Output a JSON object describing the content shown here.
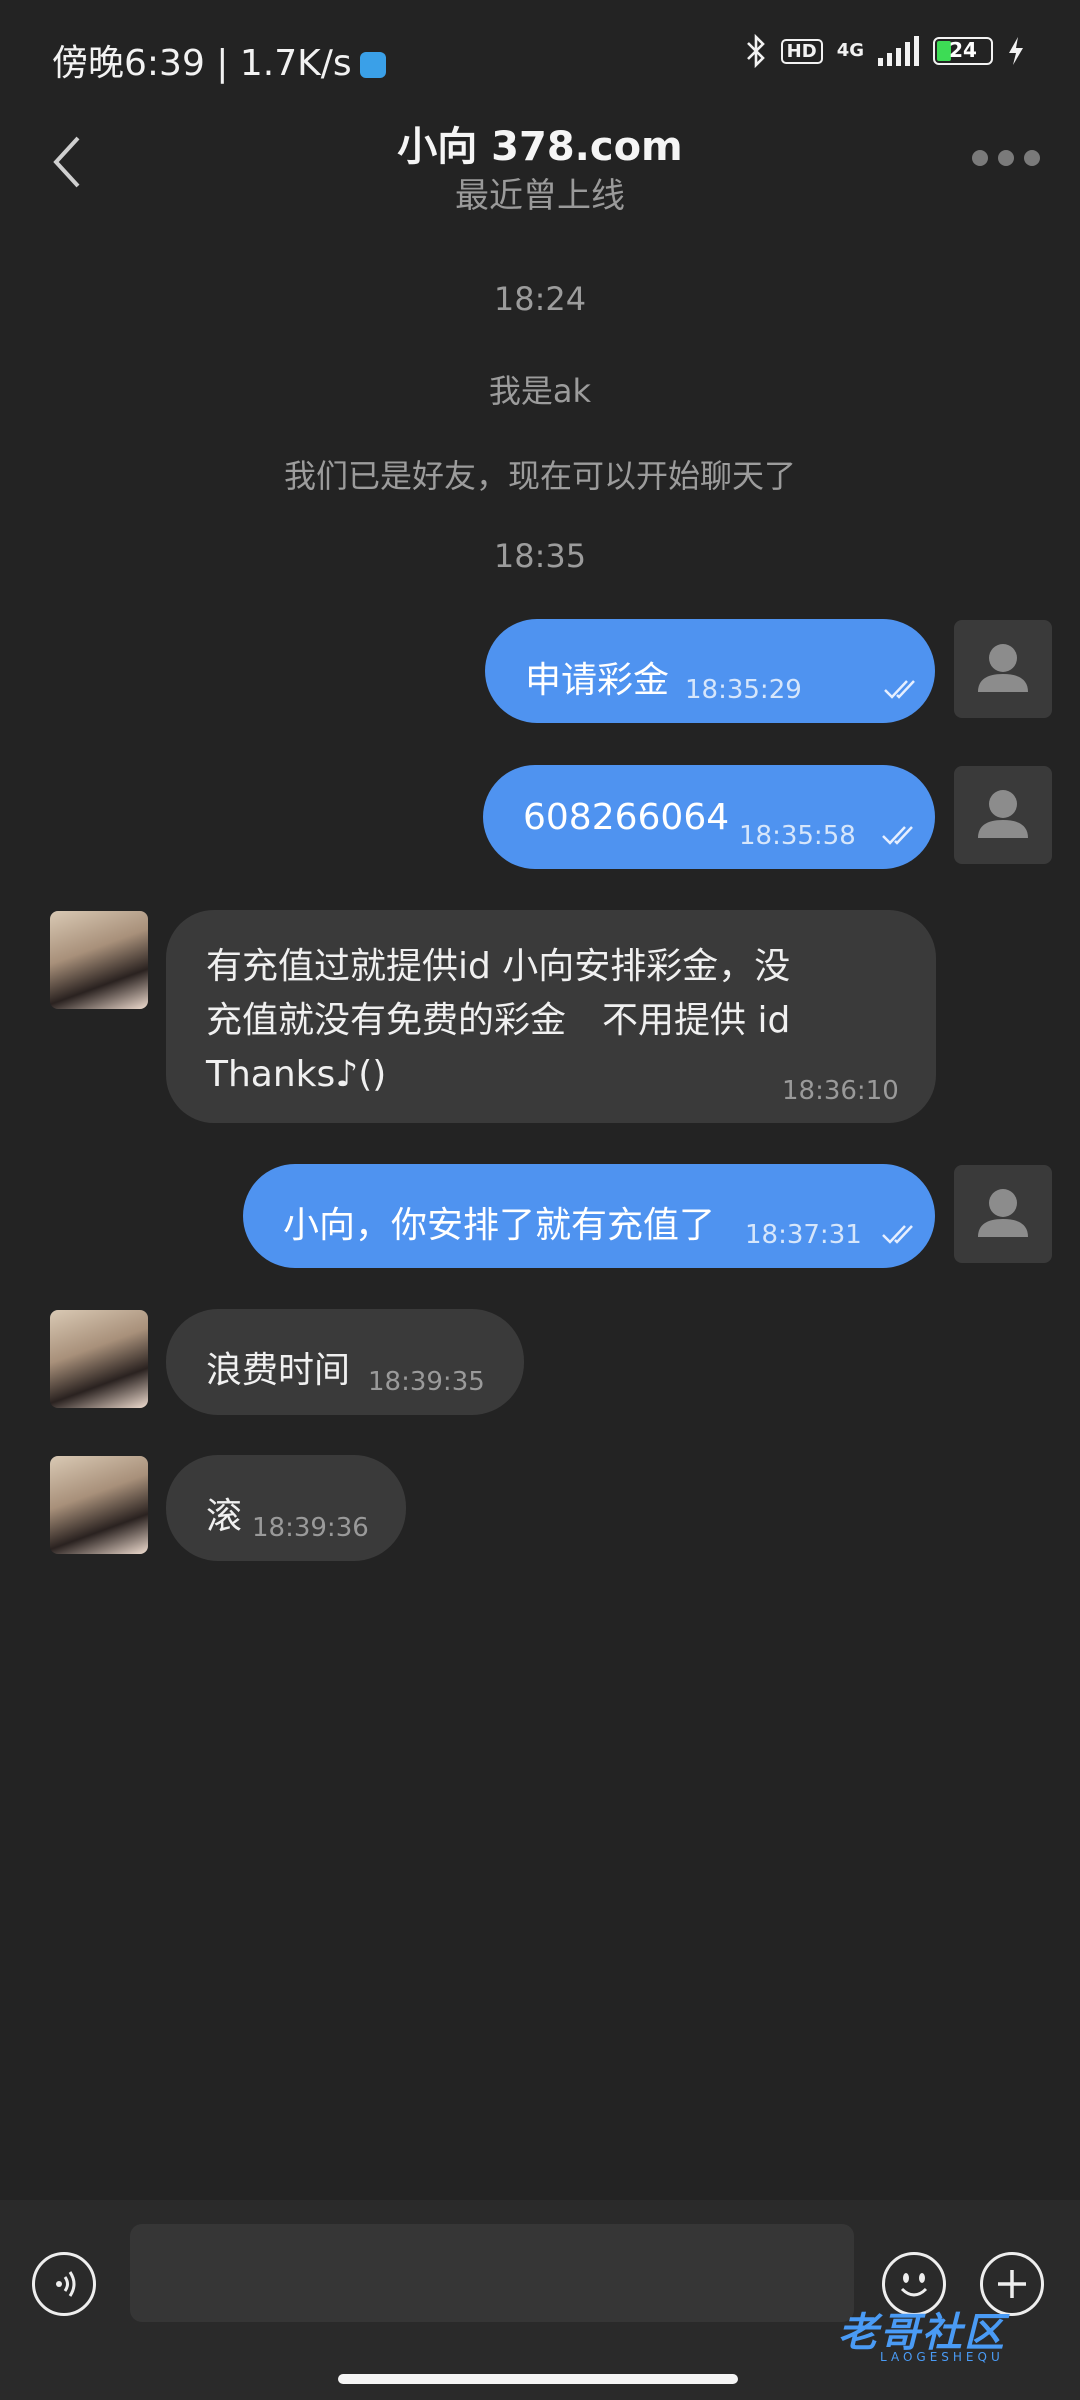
{
  "status_bar": {
    "time": "傍晚6:39 | 1.7K/s",
    "network_type": "4G",
    "hd_label": "HD",
    "battery": "24"
  },
  "header": {
    "title": "小向 378.com",
    "subtitle": "最近曾上线"
  },
  "system_messages": [
    {
      "text": "18:24"
    },
    {
      "text": "我是ak"
    },
    {
      "text": "我们已是好友，现在可以开始聊天了"
    },
    {
      "text": "18:35"
    }
  ],
  "messages": [
    {
      "side": "out",
      "text": "申请彩金",
      "time": "18:35:29"
    },
    {
      "side": "out",
      "text": "608266064",
      "time": "18:35:58"
    },
    {
      "side": "in",
      "lines": [
        "有充值过就提供id 小向安排彩金，没",
        "充值就没有免费的彩金　不用提供 id",
        "Thanks♪()"
      ],
      "time": "18:36:10"
    },
    {
      "side": "out",
      "text": "小向，你安排了就有充值了",
      "time": "18:37:31"
    },
    {
      "side": "in",
      "text": "浪费时间",
      "time": "18:39:35"
    },
    {
      "side": "in",
      "text": "滚",
      "time": "18:39:36"
    }
  ],
  "watermark": {
    "text": "老哥社区",
    "sub": "LAOGESHEQU"
  },
  "colors": {
    "background": "#232323",
    "outgoing_bubble": "#4f93f0",
    "incoming_bubble": "#3a3a3a"
  }
}
